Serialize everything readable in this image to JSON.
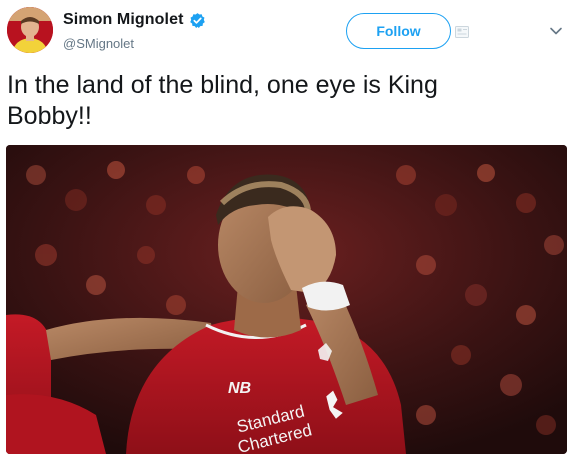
{
  "tweet": {
    "author": {
      "display_name": "Simon Mignolet",
      "handle": "@SMignolet",
      "verified_icon": "verified-badge-icon",
      "avatar_icon": "avatar"
    },
    "follow_button_label": "Follow",
    "text_line1": "In the land of the blind, one eye is King",
    "text_line2": "Bobby!!",
    "media": {
      "sponsor_line1": "Standard",
      "sponsor_line2": "Chartered",
      "kit_brand": "NB"
    }
  },
  "colors": {
    "accent": "#1da1f2",
    "name_text": "#14171a",
    "handle_text": "#657786",
    "kit_red": "#c8102e"
  }
}
